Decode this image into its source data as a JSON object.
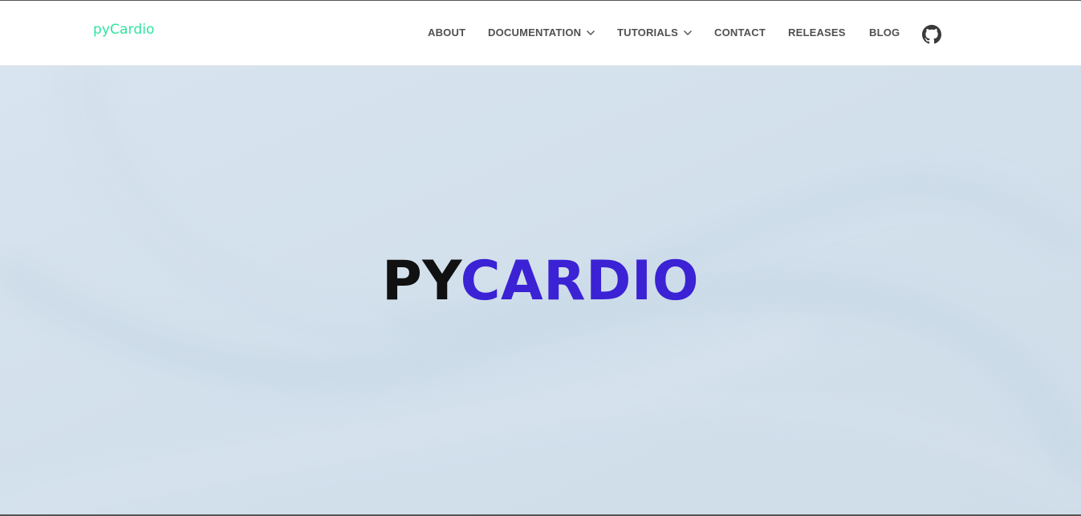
{
  "brand": {
    "name": "pyCardio",
    "color": "#2ee59d"
  },
  "nav": {
    "about": "ABOUT",
    "documentation": "DOCUMENTATION",
    "tutorials": "TUTORIALS",
    "contact": "CONTACT",
    "releases": "RELEASES",
    "blog": "BLOG",
    "github_icon": "github-icon",
    "dropdown_icon": "chevron-down-icon"
  },
  "hero": {
    "title_part1": "PY",
    "title_part2": "CARDIO",
    "title_part2_color": "#3b22d4",
    "background_color": "#d4e2ee"
  }
}
